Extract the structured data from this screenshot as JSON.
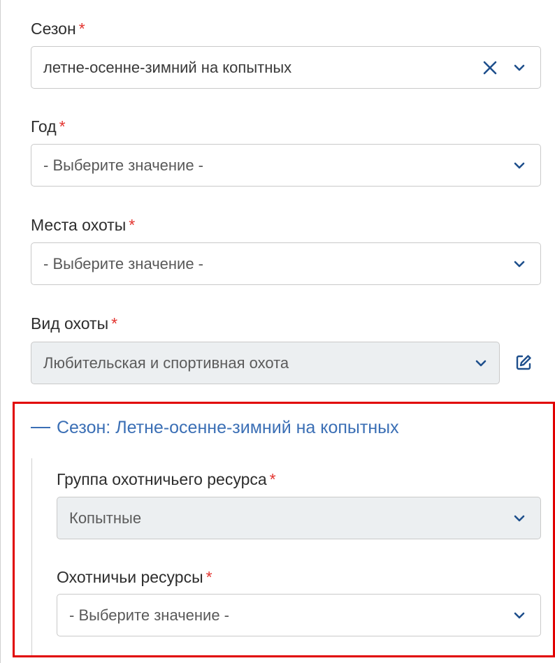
{
  "form": {
    "season": {
      "label": "Сезон",
      "required_mark": "*",
      "value": "летне-осенне-зимний на копытных"
    },
    "year": {
      "label": "Год",
      "required_mark": "*",
      "placeholder": "- Выберите значение -"
    },
    "hunting_places": {
      "label": "Места охоты",
      "required_mark": "*",
      "placeholder": "- Выберите значение -"
    },
    "hunting_type": {
      "label": "Вид охоты",
      "required_mark": "*",
      "value": "Любительская и спортивная охота"
    }
  },
  "section": {
    "title": "Сезон: Летне-осенне-зимний на копытных",
    "resource_group": {
      "label": "Группа охотничьего ресурса",
      "required_mark": "*",
      "value": "Копытные"
    },
    "resources": {
      "label": "Охотничьи ресурсы",
      "required_mark": "*",
      "placeholder": "- Выберите значение -"
    }
  },
  "colors": {
    "required": "#e3342f",
    "section_title": "#3b6fb5",
    "highlight_border": "#e10000",
    "disabled_bg": "#eceff1",
    "icon_blue": "#1e4f8c"
  },
  "icons": {
    "clear": "close-icon",
    "dropdown": "chevron-down-icon",
    "edit": "edit-icon",
    "collapse": "minus-icon"
  }
}
